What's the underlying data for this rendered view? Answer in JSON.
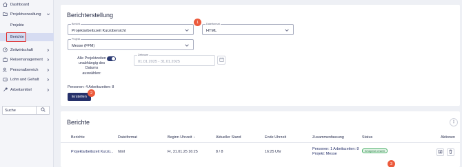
{
  "sidebar": {
    "items": [
      {
        "label": "Dashboard",
        "icon": "home-icon"
      },
      {
        "label": "Projektverwaltung",
        "icon": "folder-icon",
        "expanded": true,
        "children": [
          {
            "label": "Projekte"
          },
          {
            "label": "Berichte",
            "active": true
          }
        ]
      },
      {
        "label": "Zeitwirtschaft",
        "icon": "clock-icon"
      },
      {
        "label": "Reisemanagement",
        "icon": "suitcase-icon"
      },
      {
        "label": "Personalbereich",
        "icon": "people-icon"
      },
      {
        "label": "Lohn und Gehalt",
        "icon": "wallet-icon"
      },
      {
        "label": "Arbeitsmittel",
        "icon": "tool-icon"
      }
    ],
    "search_value": "Suche"
  },
  "report_form": {
    "title": "Berichterstellung",
    "bericht_label": "Bericht",
    "bericht_value": "Projektarbeitszeit Kurzübersicht",
    "dateiformat_label": "Dateiformat",
    "dateiformat_value": "HTML",
    "projekt_label": "Projekt",
    "projekt_value": "Messe (FFM)",
    "toggle_label": "Alle Projektzeiten unabhängig des Datums auswählen:",
    "toggle_on": true,
    "zeitraum_label": "Zeitraum",
    "zeitraum_value": "01.01.2025 - 31.01.2025",
    "info": "Personen: 4 Arbeitszeiten: 8",
    "create_button": "Erstellen"
  },
  "badges": {
    "one": "1",
    "two": "2",
    "three": "3"
  },
  "reports_table": {
    "title": "Berichte",
    "columns": [
      "Berichte",
      "Dateiformat",
      "Beginn Uhrzeit",
      "Aktueller Stand",
      "Ende Uhrzeit",
      "Zusammenfassung",
      "Status",
      "Aktionen"
    ],
    "rows": [
      {
        "bericht": "Projektarbeitszeit Kurzü...",
        "format": "html",
        "beginn": "Fr, 31.01.25 16:25",
        "stand": "8 / 8",
        "ende": "16:25 Uhr",
        "zusammenfassung_1": "Personen: 1 Arbeitszeiten: 8",
        "zusammenfassung_2": "Projekt: Messe",
        "status": "Erfolgreich erstellt"
      }
    ]
  },
  "colors": {
    "accent": "#25306a",
    "badge": "#ec5a3c",
    "highlight": "#e03131",
    "success": "#4caf6a"
  }
}
